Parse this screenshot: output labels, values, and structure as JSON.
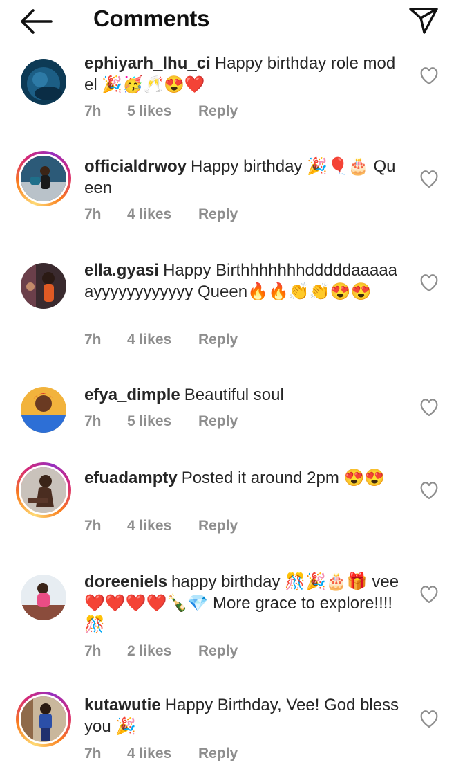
{
  "header": {
    "title": "Comments"
  },
  "comments": [
    {
      "username": "ephiyarh_lhu_ci",
      "text": "Happy birthday role model 🎉🥳🥂😍❤️",
      "time": "7h",
      "likes": "5 likes",
      "reply": "Reply",
      "story": false
    },
    {
      "username": "officialdrwoy",
      "text": "Happy birthday 🎉🎈🎂 Queen",
      "time": "7h",
      "likes": "4 likes",
      "reply": "Reply",
      "story": true
    },
    {
      "username": "ella.gyasi",
      "text": "Happy Birthhhhhhhdddddaaaaaayyyyyyyyyyyy Queen🔥🔥👏👏😍😍",
      "time": "7h",
      "likes": "4 likes",
      "reply": "Reply",
      "story": false
    },
    {
      "username": "efya_dimple",
      "text": "Beautiful soul",
      "time": "7h",
      "likes": "5 likes",
      "reply": "Reply",
      "story": false
    },
    {
      "username": "efuadampty",
      "text": "Posted it around 2pm 😍😍",
      "time": "7h",
      "likes": "4 likes",
      "reply": "Reply",
      "story": true
    },
    {
      "username": "doreeniels",
      "text": "happy birthday 🎊🎉🎂🎁 vee❤️❤️❤️❤️🍾💎 More grace to explore!!!!🎊",
      "time": "7h",
      "likes": "2 likes",
      "reply": "Reply",
      "story": false
    },
    {
      "username": "kutawutie",
      "text": "Happy Birthday, Vee! God bless you 🎉",
      "time": "7h",
      "likes": "4 likes",
      "reply": "Reply",
      "story": true
    }
  ],
  "icons": {
    "back": "arrow-left-icon",
    "send": "paper-plane-icon",
    "like": "heart-outline-icon"
  },
  "colors": {
    "text": "#262626",
    "meta": "#8e8e8e",
    "story_ring": "#d62976"
  }
}
